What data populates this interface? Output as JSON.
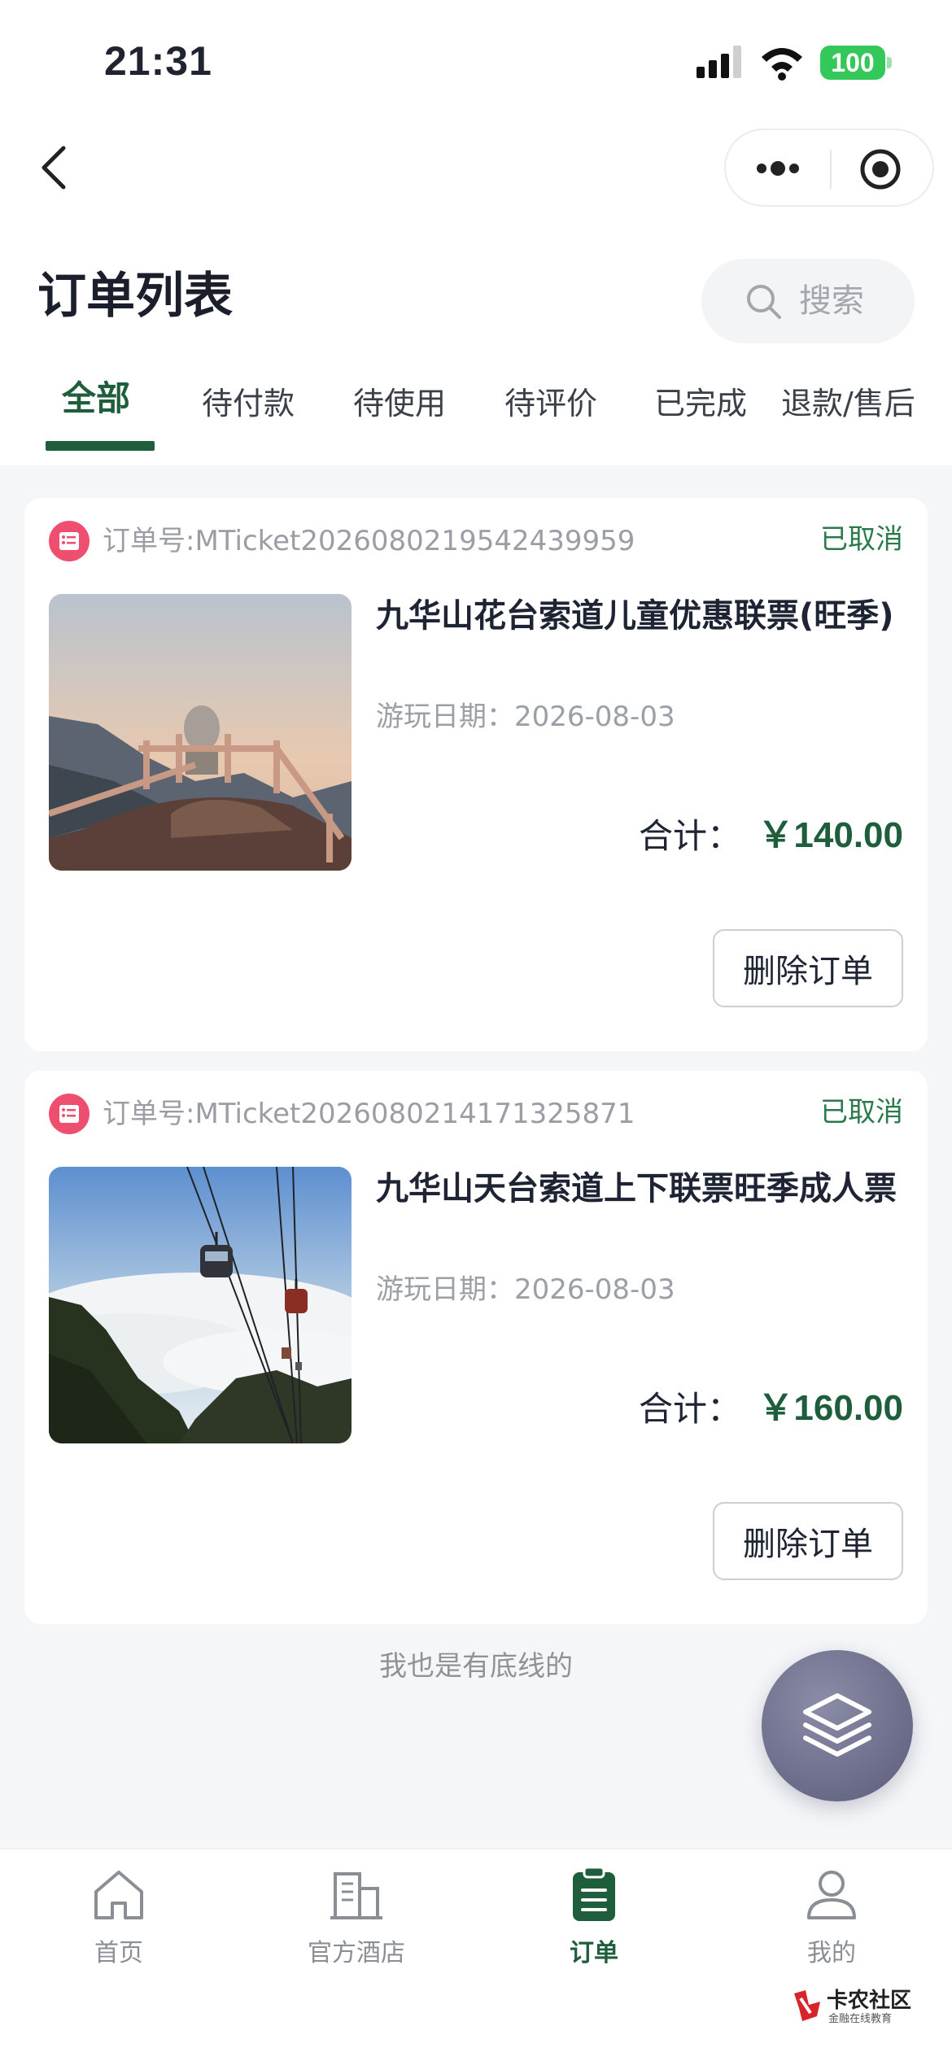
{
  "status_bar": {
    "time": "21:31",
    "battery": "100"
  },
  "header": {
    "title": "订单列表",
    "search_placeholder": "搜索"
  },
  "tabs": [
    {
      "label": "全部",
      "active": true
    },
    {
      "label": "待付款"
    },
    {
      "label": "待使用"
    },
    {
      "label": "待评价"
    },
    {
      "label": "已完成"
    },
    {
      "label": "退款/售后"
    }
  ],
  "orders": [
    {
      "order_no": "订单号:MTicket2026080219542439959",
      "status": "已取消",
      "title": "九华山花台索道儿童优惠联票(旺季)",
      "play_date": "游玩日期：2026-08-03",
      "total_label": "合计：",
      "total": "￥140.00",
      "delete_label": "删除订单"
    },
    {
      "order_no": "订单号:MTicket2026080214171325871",
      "status": "已取消",
      "title": "九华山天台索道上下联票旺季成人票",
      "play_date": "游玩日期：2026-08-03",
      "total_label": "合计：",
      "total": "￥160.00",
      "delete_label": "删除订单"
    }
  ],
  "list_footer": "我也是有底线的",
  "tabbar": [
    {
      "label": "首页",
      "icon": "home-icon"
    },
    {
      "label": "官方酒店",
      "icon": "building-icon"
    },
    {
      "label": "订单",
      "icon": "clipboard-icon",
      "active": true
    },
    {
      "label": "我的",
      "icon": "user-icon"
    }
  ],
  "watermark": {
    "text": "卡农社区",
    "sub": "金融在线教育"
  },
  "colors": {
    "accent": "#1f5e3c",
    "status": "#2a7a4b",
    "order_icon": "#ef4f6e",
    "battery": "#34c759"
  }
}
